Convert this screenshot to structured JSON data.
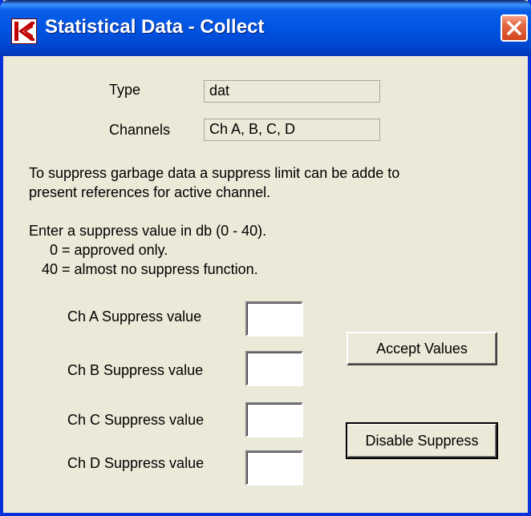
{
  "window": {
    "title": "Statistical Data - Collect",
    "app_icon": "k-logo-icon",
    "close_icon": "close-icon"
  },
  "info": {
    "type_label": "Type",
    "type_value": "dat",
    "channels_label": "Channels",
    "channels_value": "Ch A, B, C, D"
  },
  "description": {
    "line1": "To suppress garbage data a suppress limit can be adde to",
    "line2": "present references for active channel."
  },
  "instructions": {
    "line1": "Enter a suppress value in db (0 - 40).",
    "line2": "0 = approved only.",
    "line3": "40 = almost no suppress function."
  },
  "suppress": [
    {
      "label": "Ch A Suppress value",
      "value": ""
    },
    {
      "label": "Ch B Suppress value",
      "value": ""
    },
    {
      "label": "Ch C Suppress value",
      "value": ""
    },
    {
      "label": "Ch D Suppress value",
      "value": ""
    }
  ],
  "buttons": {
    "accept": "Accept Values",
    "disable": "Disable Suppress"
  },
  "colors": {
    "titlebar": "#0054e3",
    "dialog_bg": "#ece9d8",
    "close": "#d2461e"
  }
}
